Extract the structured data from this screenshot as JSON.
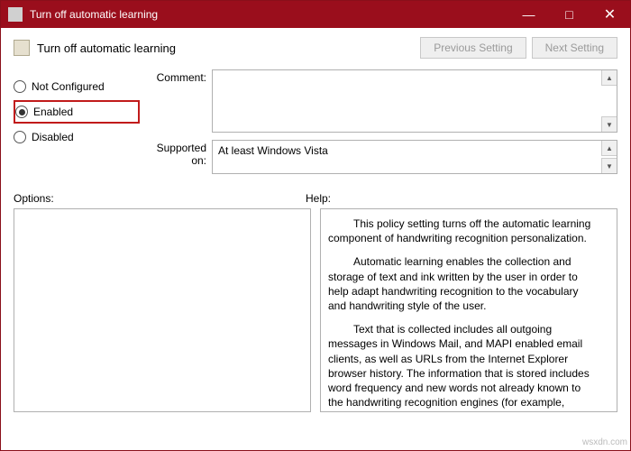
{
  "window": {
    "title": "Turn off automatic learning"
  },
  "header": {
    "title": "Turn off automatic learning",
    "prev": "Previous Setting",
    "next": "Next Setting"
  },
  "radios": {
    "not_configured": "Not Configured",
    "enabled": "Enabled",
    "disabled": "Disabled"
  },
  "labels": {
    "comment": "Comment:",
    "supported": "Supported on:",
    "options": "Options:",
    "help": "Help:"
  },
  "supported_value": "At least Windows Vista",
  "help": {
    "p1": "This policy setting turns off the automatic learning component of handwriting recognition personalization.",
    "p2": "Automatic learning enables the collection and storage of text and ink written by the user in order to help adapt handwriting recognition to the vocabulary and handwriting style of the user.",
    "p3": "Text that is collected includes all outgoing messages in Windows Mail, and MAPI enabled email clients, as well as URLs from the Internet Explorer browser history. The information that is stored includes word frequency and new words not already known to the handwriting recognition engines (for example, proper names and acronyms). Deleting email content or the browser history does not delete the stored"
  },
  "watermark": "wsxdn.com"
}
